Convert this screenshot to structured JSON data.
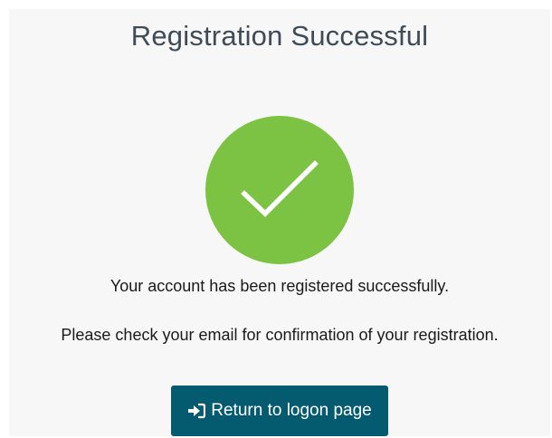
{
  "header": {
    "title": "Registration Successful"
  },
  "status": {
    "icon": "check-icon",
    "circle_color": "#7cc243"
  },
  "messages": {
    "line1": "Your account has been registered successfully.",
    "line2": "Please check your email for confirmation of your registration."
  },
  "actions": {
    "return_label": "Return to logon page",
    "return_icon": "sign-in-icon",
    "button_color": "#045a6e"
  }
}
